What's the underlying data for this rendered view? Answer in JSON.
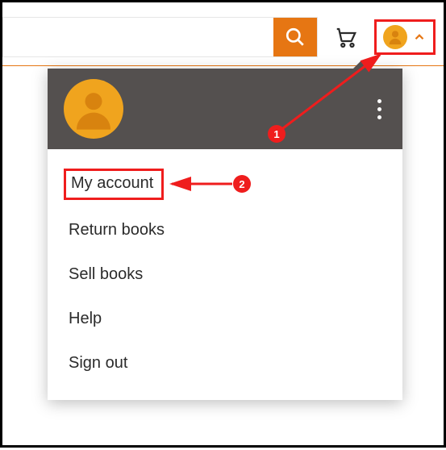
{
  "search": {
    "value": "",
    "placeholder": ""
  },
  "dropdown": {
    "items": [
      {
        "label": "My account"
      },
      {
        "label": "Return books"
      },
      {
        "label": "Sell books"
      },
      {
        "label": "Help"
      },
      {
        "label": "Sign out"
      }
    ]
  },
  "annotations": {
    "step1": "1",
    "step2": "2"
  }
}
